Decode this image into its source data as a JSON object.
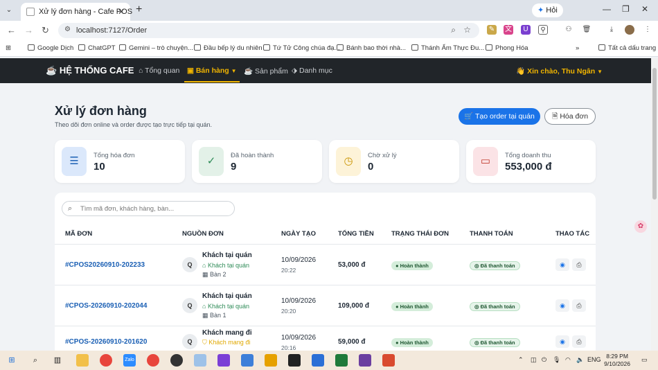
{
  "browser": {
    "tab_title": "Xử lý đơn hàng - Cafe POS",
    "ai_tab_label": "Hỏi",
    "url": "localhost:7127/Order",
    "bookmarks": [
      "Google Dịch",
      "ChatGPT",
      "Gemini – trò chuyện...",
      "Đầu bếp lý du nhiên",
      "Tứ Tử Công chúa đạ...",
      "Bánh bao thời nhà...",
      "Thánh Ẩm Thực Đu...",
      "Phong Hóa"
    ],
    "all_bookmarks": "Tất cả dấu trang"
  },
  "app": {
    "brand": "HỆ THỐNG CAFE",
    "menu": [
      "Tổng quan",
      "Bán hàng",
      "Sản phẩm",
      "Danh mục"
    ],
    "greeting": "Xin chào, Thu Ngân"
  },
  "page": {
    "title": "Xử lý đơn hàng",
    "subtitle": "Theo dõi đơn online và order được tạo trực tiếp tại quán.",
    "create_button": "Tạo order tại quán",
    "invoice_button": "Hóa đơn"
  },
  "stats": [
    {
      "label": "Tổng hóa đơn",
      "value": "10",
      "icon": "document-icon",
      "color": "#dbe8fb"
    },
    {
      "label": "Đã hoàn thành",
      "value": "9",
      "icon": "check-circle-icon",
      "color": "#e3f1e8"
    },
    {
      "label": "Chờ xử lý",
      "value": "0",
      "icon": "clock-icon",
      "color": "#fdf3d8"
    },
    {
      "label": "Tổng doanh thu",
      "value": "553,000 đ",
      "icon": "cash-icon",
      "color": "#fbe3e6"
    }
  ],
  "search": {
    "placeholder": "Tìm mã đơn, khách hàng, bàn..."
  },
  "table": {
    "headers": [
      "MÃ ĐƠN",
      "NGUỒN ĐƠN",
      "NGÀY TẠO",
      "TỔNG TIỀN",
      "TRẠNG THÁI ĐƠN",
      "THANH TOÁN",
      "THAO TÁC"
    ],
    "rows": [
      {
        "id": "#CPOS20260910-202233",
        "avatar": "Q",
        "name": "Khách tại quán",
        "type": "Khách tại quán",
        "table": "Bàn 2",
        "date": "10/09/2026",
        "time": "20:22",
        "total": "53,000 đ",
        "status": "Hoàn thành",
        "payment": "Đã thanh toán"
      },
      {
        "id": "#CPOS-20260910-202044",
        "avatar": "Q",
        "name": "Khách tại quán",
        "type": "Khách tại quán",
        "table": "Bàn 1",
        "date": "10/09/2026",
        "time": "20:20",
        "total": "109,000 đ",
        "status": "Hoàn thành",
        "payment": "Đã thanh toán"
      },
      {
        "id": "#CPOS-20260910-201620",
        "avatar": "Q",
        "name": "Khách mang đi",
        "type": "Khách mang đi",
        "table": "",
        "date": "10/09/2026",
        "time": "20:16",
        "total": "59,000 đ",
        "status": "Hoàn thành",
        "payment": "Đã thanh toán"
      }
    ]
  },
  "taskbar": {
    "lang": "ENG",
    "time": "8:29 PM",
    "date": "9/10/2026"
  },
  "colors": {
    "primary": "#1a73e8",
    "accent": "#f0b400",
    "header": "#212529"
  }
}
